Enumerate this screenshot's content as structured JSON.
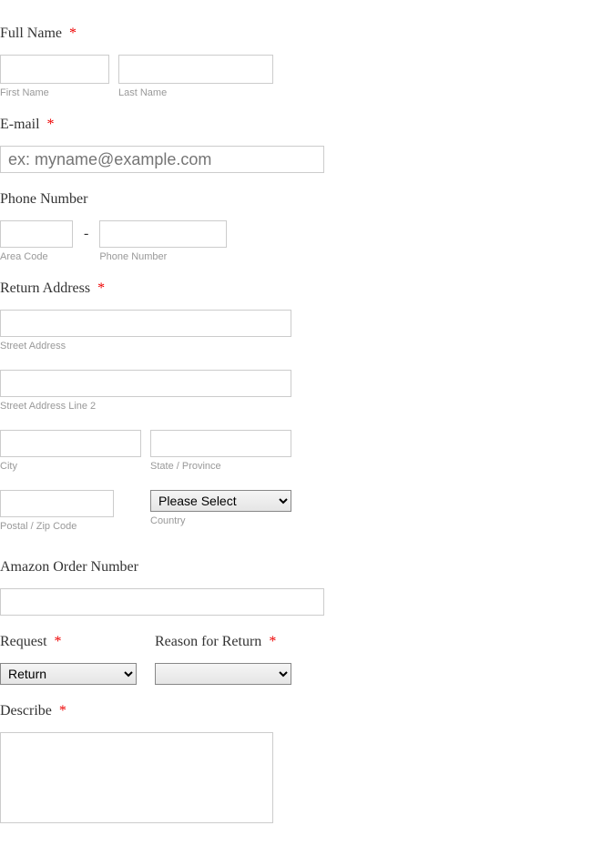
{
  "fullName": {
    "label": "Full Name",
    "required": "*",
    "first": {
      "value": "",
      "sublabel": "First Name"
    },
    "last": {
      "value": "",
      "sublabel": "Last Name"
    }
  },
  "email": {
    "label": "E-mail",
    "required": "*",
    "placeholder": "ex: myname@example.com",
    "value": ""
  },
  "phone": {
    "label": "Phone Number",
    "area": {
      "value": "",
      "sublabel": "Area Code"
    },
    "number": {
      "value": "",
      "sublabel": "Phone Number"
    },
    "separator": "-"
  },
  "address": {
    "label": "Return Address",
    "required": "*",
    "street1": {
      "value": "",
      "sublabel": "Street Address"
    },
    "street2": {
      "value": "",
      "sublabel": "Street Address Line 2"
    },
    "city": {
      "value": "",
      "sublabel": "City"
    },
    "state": {
      "value": "",
      "sublabel": "State / Province"
    },
    "postal": {
      "value": "",
      "sublabel": "Postal / Zip Code"
    },
    "country": {
      "selected": "Please Select",
      "sublabel": "Country"
    }
  },
  "orderNumber": {
    "label": "Amazon Order Number",
    "value": ""
  },
  "request": {
    "label": "Request",
    "required": "*",
    "selected": "Return"
  },
  "reason": {
    "label": "Reason for Return",
    "required": "*",
    "selected": ""
  },
  "describe": {
    "label": "Describe",
    "required": "*",
    "value": ""
  }
}
